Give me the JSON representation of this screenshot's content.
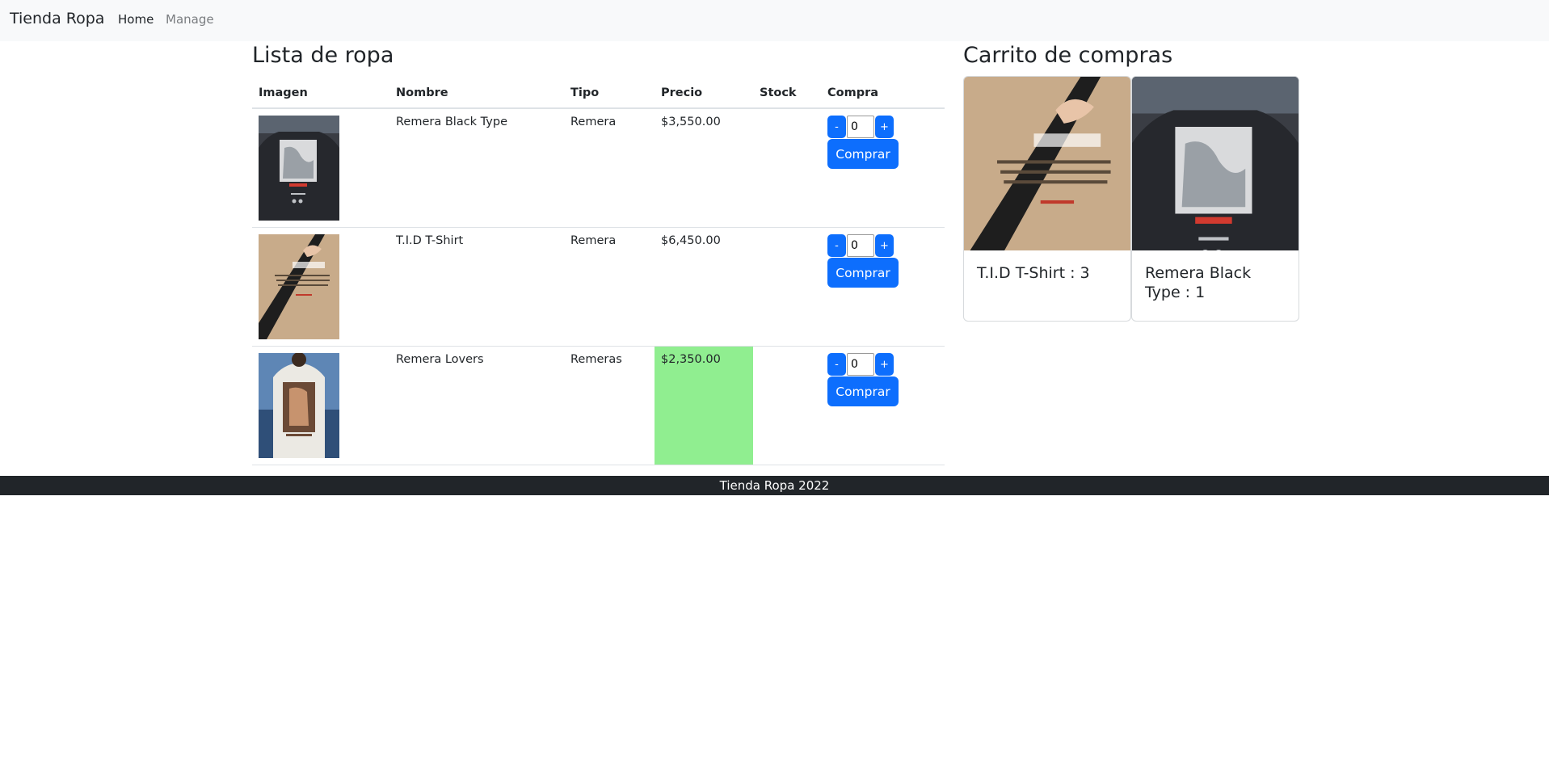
{
  "navbar": {
    "brand": "Tienda Ropa",
    "links": [
      {
        "label": "Home"
      },
      {
        "label": "Manage"
      }
    ]
  },
  "products": {
    "title": "Lista de ropa",
    "columns": [
      "Imagen",
      "Nombre",
      "Tipo",
      "Precio",
      "Stock",
      "Compra"
    ],
    "rows": [
      {
        "name": "Remera Black Type",
        "type": "Remera",
        "price": "$3,550.00",
        "stock": "",
        "qty": "0",
        "dec_label": "-",
        "inc_label": "+",
        "buy_label": "Comprar",
        "highlight": false
      },
      {
        "name": "T.I.D T-Shirt",
        "type": "Remera",
        "price": "$6,450.00",
        "stock": "",
        "qty": "0",
        "dec_label": "-",
        "inc_label": "+",
        "buy_label": "Comprar",
        "highlight": false
      },
      {
        "name": "Remera Lovers",
        "type": "Remeras",
        "price": "$2,350.00",
        "stock": "",
        "qty": "0",
        "dec_label": "-",
        "inc_label": "+",
        "buy_label": "Comprar",
        "highlight": true
      }
    ],
    "highlight_color": "#90ee90",
    "button_color": "#0d6efd"
  },
  "cart": {
    "title": "Carrito de compras",
    "items": [
      {
        "label": "T.I.D T-Shirt : 3"
      },
      {
        "label": "Remera Black Type : 1"
      }
    ]
  },
  "footer": {
    "text": "Tienda Ropa 2022"
  }
}
